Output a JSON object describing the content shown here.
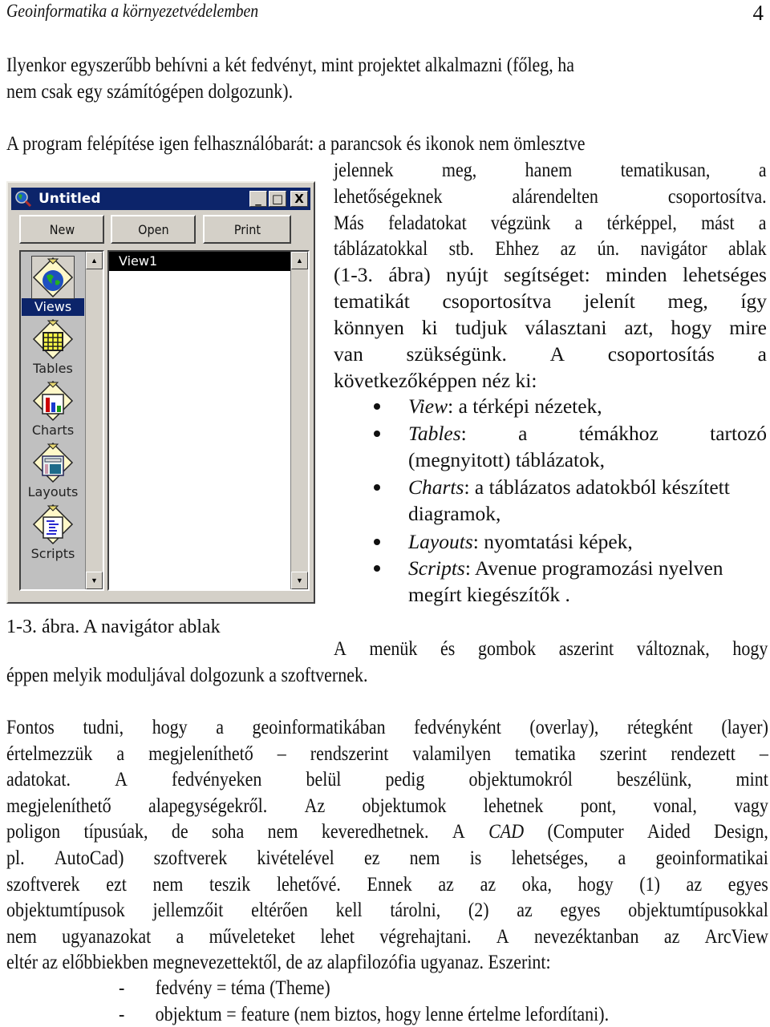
{
  "header": {
    "title": "Geoinformatika a környezetvédelemben",
    "page_number": "4"
  },
  "intro_paragraph": {
    "lines": [
      "Ilyenkor egyszerűbb behívni a két fedvényt, mint projektet alkalmazni (főleg, ha",
      "nem csak egy számítógépen dolgozunk)."
    ]
  },
  "program_paragraph": {
    "first_line": "A program felépítése igen felhasználóbarát: a parancsok és ikonok nem ömlesztve",
    "wrapped_lines": [
      [
        "jelennek",
        "meg,",
        "hanem",
        "tematikusan,",
        "a"
      ],
      [
        "lehetőségeknek",
        "alárendelten",
        "csoportosítva."
      ],
      [
        "Más",
        "feladatokat",
        "végzünk",
        "a",
        "térképpel,",
        "mást",
        "a"
      ],
      [
        "táblázatokkal",
        "stb.",
        "Ehhez",
        "az",
        "ún.",
        "navigátor",
        "ablak"
      ],
      [
        "(1-3.",
        "ábra)",
        "nyújt",
        "segítséget:",
        "minden",
        "lehetséges"
      ],
      [
        "tematikát",
        "csoportosítva",
        "jelenít",
        "meg,",
        "így"
      ],
      [
        "könnyen",
        "ki",
        "tudjuk",
        "választani",
        "azt,",
        "hogy",
        "mire"
      ],
      [
        "van",
        "szükségünk.",
        "A",
        "csoportosítás",
        "a"
      ]
    ],
    "last_line": "következőképpen néz ki:"
  },
  "bullets": [
    {
      "term": "View",
      "text_lines": [
        ": a térképi nézetek,"
      ]
    },
    {
      "term": "Tables",
      "text_lines": [
        ":",
        "a",
        "témákhoz",
        "tartozó"
      ],
      "continuation": "(megnyitott) táblázatok,"
    },
    {
      "term": "Charts",
      "text_lines": [
        ": a táblázatos adatokból készített"
      ],
      "continuation": "diagramok,"
    },
    {
      "term": "Layouts",
      "text_lines": [
        ": nyomtatási képek,"
      ]
    },
    {
      "term": "Scripts",
      "text_lines": [
        ": Avenue programozási nyelven"
      ],
      "continuation": "megírt kiegészítők ."
    }
  ],
  "figure": {
    "caption": "1-3. ábra. A navigátor ablak",
    "window": {
      "title": "Untitled",
      "controls": {
        "minimize": "_",
        "maximize": "□",
        "close": "X"
      },
      "toolbar": [
        {
          "label": "New"
        },
        {
          "label": "Open"
        },
        {
          "label": "Print"
        }
      ],
      "nav_items": [
        {
          "label": "Views",
          "icon": "globe-icon",
          "selected": true
        },
        {
          "label": "Tables",
          "icon": "table-grid-icon",
          "selected": false
        },
        {
          "label": "Charts",
          "icon": "bar-chart-icon",
          "selected": false
        },
        {
          "label": "Layouts",
          "icon": "layout-icon",
          "selected": false
        },
        {
          "label": "Scripts",
          "icon": "script-icon",
          "selected": false
        }
      ],
      "documents": [
        {
          "label": "View1",
          "selected": true
        }
      ],
      "scroll_up": "▲",
      "scroll_down": "▼",
      "colors": {
        "titlebar": "#0c246a",
        "face": "#d4d0c8",
        "selection": "#000000"
      }
    }
  },
  "menus_paragraph": {
    "first_line": "A menük és gombok aszerint változnak, hogy",
    "second_line": "éppen melyik moduljával dolgozunk a szoftvernek."
  },
  "main_paragraph": {
    "lines": [
      [
        "Fontos",
        "tudni,",
        "hogy",
        "a",
        "geoinformatikában",
        "fedvényként",
        "(overlay),",
        "rétegként",
        "(layer)"
      ],
      [
        "értelmezzük",
        "a",
        "megjeleníthető",
        "–",
        "rendszerint",
        "valamilyen",
        "tematika",
        "szerint",
        "rendezett",
        "–"
      ],
      [
        "adatokat.",
        "A",
        "fedvényeken",
        "belül",
        "pedig",
        "objektumokról",
        "beszélünk,",
        "mint"
      ],
      [
        "megjeleníthető",
        "alapegységekről.",
        "Az",
        "objektumok",
        "lehetnek",
        "pont,",
        "vonal,",
        "vagy"
      ],
      [
        "poligon",
        "típusúak,",
        "de",
        "soha",
        "nem",
        "keveredhetnek.",
        "A",
        "CAD",
        "(Computer",
        "Aided",
        "Design,"
      ],
      [
        "pl.",
        "AutoCad)",
        "szoftverek",
        "kivételével",
        "ez",
        "nem",
        "is",
        "lehetséges,",
        "a",
        "geoinformatikai"
      ],
      [
        "szoftverek",
        "ezt",
        "nem",
        "teszik",
        "lehetővé.",
        "Ennek",
        "az",
        "az",
        "oka,",
        "hogy",
        "(1)",
        "az",
        "egyes"
      ],
      [
        "objektumtípusok",
        "jellemzőit",
        "eltérően",
        "kell",
        "tárolni,",
        "(2)",
        "az",
        "egyes",
        "objektumtípusokkal"
      ],
      [
        "nem",
        "ugyanazokat",
        "a",
        "műveleteket",
        "lehet",
        "végrehajtani.",
        "A",
        "nevezéktanban",
        "az",
        "ArcView"
      ]
    ],
    "last_line": "eltér az előbbiekben megnevezettektől, de az alapfilozófia ugyanaz. Eszerint:",
    "italic_word": "CAD"
  },
  "dash_list": [
    "fedvény = téma (Theme)",
    "objektum = feature (nem biztos, hogy lenne értelme lefordítani)."
  ]
}
